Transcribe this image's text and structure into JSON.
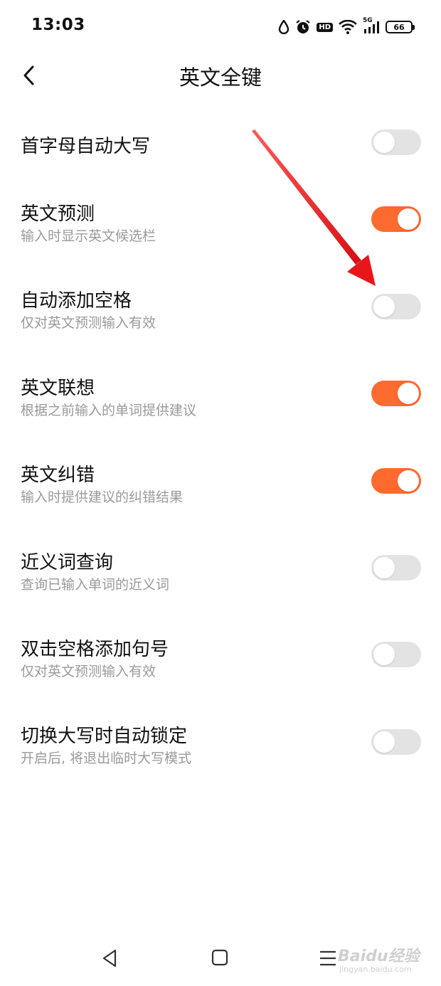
{
  "status_bar": {
    "time": "13:03",
    "network_label": "5G",
    "hd_label": "HD",
    "battery_level": "66",
    "icons": [
      "water-drop-icon",
      "alarm-icon",
      "hd-icon",
      "wifi-icon",
      "signal-5g-icon",
      "battery-icon"
    ]
  },
  "header": {
    "title": "英文全键",
    "back_icon": "chevron-left-icon"
  },
  "settings": [
    {
      "title": "首字母自动大写",
      "subtitle": "",
      "enabled": false
    },
    {
      "title": "英文预测",
      "subtitle": "输入时显示英文候选栏",
      "enabled": true
    },
    {
      "title": "自动添加空格",
      "subtitle": "仅对英文预测输入有效",
      "enabled": false
    },
    {
      "title": "英文联想",
      "subtitle": "根据之前输入的单词提供建议",
      "enabled": true
    },
    {
      "title": "英文纠错",
      "subtitle": "输入时提供建议的纠错结果",
      "enabled": true
    },
    {
      "title": "近义词查询",
      "subtitle": "查询已输入单词的近义词",
      "enabled": false
    },
    {
      "title": "双击空格添加句号",
      "subtitle": "仅对英文预测输入有效",
      "enabled": false
    },
    {
      "title": "切换大写时自动锁定",
      "subtitle": "开启后, 将退出临时大写模式",
      "enabled": false
    }
  ],
  "colors": {
    "toggle_on": "#ff6a2f",
    "toggle_off": "#e3e3e3",
    "annotation_arrow": "#e8161b"
  },
  "nav_bar": {
    "icons": [
      "nav-back-icon",
      "nav-home-icon",
      "nav-menu-icon"
    ]
  },
  "watermark": {
    "main": "Baidu经验",
    "sub": "jingyan.baidu.com"
  }
}
